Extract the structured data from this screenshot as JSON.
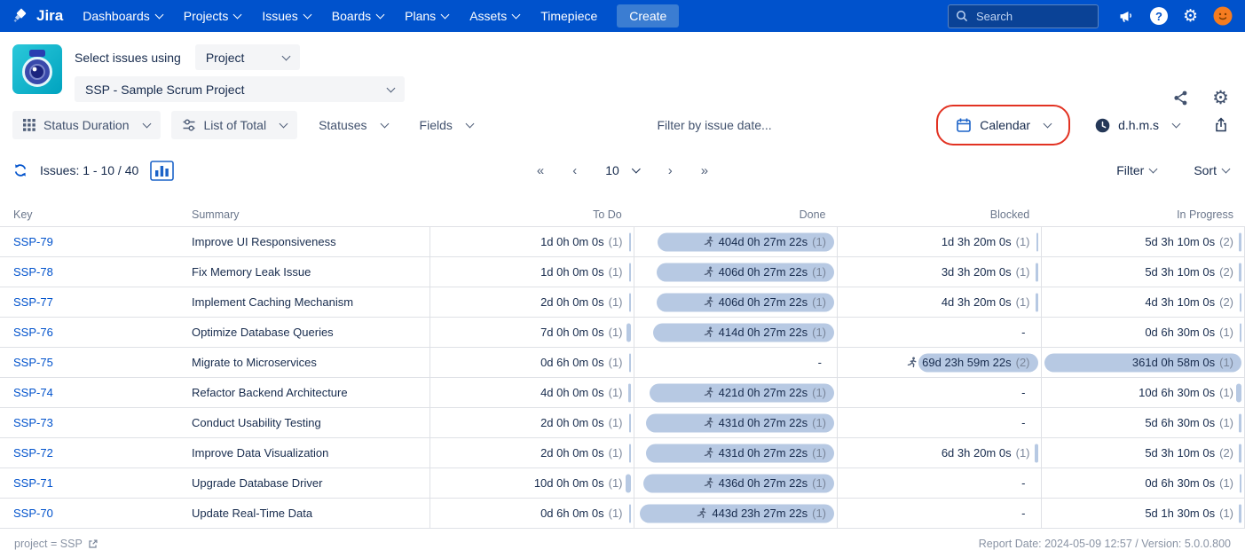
{
  "nav": {
    "brand": "Jira",
    "items": [
      "Dashboards",
      "Projects",
      "Issues",
      "Boards",
      "Plans",
      "Assets",
      "Timepiece"
    ],
    "create_label": "Create",
    "search_placeholder": "Search"
  },
  "panel": {
    "select_label": "Select issues using",
    "mode_value": "Project",
    "project_value": "SSP - Sample Scrum Project"
  },
  "toolbar": {
    "status_duration": "Status Duration",
    "list_of_total": "List of Total",
    "statuses": "Statuses",
    "fields": "Fields",
    "date_filter_placeholder": "Filter by issue date...",
    "calendar": "Calendar",
    "time_format": "d.h.m.s"
  },
  "pager": {
    "issues_label": "Issues: 1 - 10 / 40",
    "page_size": "10",
    "controls": {
      "first": "«",
      "prev": "‹",
      "next": "›",
      "last": "»"
    },
    "filter": "Filter",
    "sort": "Sort"
  },
  "icons": {
    "gear": "⚙"
  },
  "table": {
    "columns": [
      "Key",
      "Summary",
      "To Do",
      "Done",
      "Blocked",
      "In Progress"
    ],
    "rows": [
      {
        "key": "SSP-79",
        "summary": "Improve UI Responsiveness",
        "todo": {
          "text": "1d 0h 0m 0s",
          "count": "(1)",
          "bar": 0.5,
          "runner": false
        },
        "done": {
          "text": "404d 0h 27m 22s",
          "count": "(1)",
          "bar": 87,
          "runner": true
        },
        "blocked": {
          "text": "1d 3h 20m 0s",
          "count": "(1)",
          "bar": 0.5,
          "runner": false
        },
        "inprogress": {
          "text": "5d 3h 10m 0s",
          "count": "(2)",
          "bar": 1.3,
          "runner": false
        }
      },
      {
        "key": "SSP-78",
        "summary": "Fix Memory Leak Issue",
        "todo": {
          "text": "1d 0h 0m 0s",
          "count": "(1)",
          "bar": 0.5,
          "runner": false
        },
        "done": {
          "text": "406d 0h 27m 22s",
          "count": "(1)",
          "bar": 87.5,
          "runner": true
        },
        "blocked": {
          "text": "3d 3h 20m 0s",
          "count": "(1)",
          "bar": 0.9,
          "runner": false
        },
        "inprogress": {
          "text": "5d 3h 10m 0s",
          "count": "(2)",
          "bar": 1.3,
          "runner": false
        }
      },
      {
        "key": "SSP-77",
        "summary": "Implement Caching Mechanism",
        "todo": {
          "text": "2d 0h 0m 0s",
          "count": "(1)",
          "bar": 0.7,
          "runner": false
        },
        "done": {
          "text": "406d 0h 27m 22s",
          "count": "(1)",
          "bar": 87.5,
          "runner": true
        },
        "blocked": {
          "text": "4d 3h 20m 0s",
          "count": "(1)",
          "bar": 1.1,
          "runner": false
        },
        "inprogress": {
          "text": "4d 3h 10m 0s",
          "count": "(2)",
          "bar": 1.1,
          "runner": false
        }
      },
      {
        "key": "SSP-76",
        "summary": "Optimize Database Queries",
        "todo": {
          "text": "7d 0h 0m 0s",
          "count": "(1)",
          "bar": 1.8,
          "runner": false
        },
        "done": {
          "text": "414d 0h 27m 22s",
          "count": "(1)",
          "bar": 89.5,
          "runner": true
        },
        "blocked": {
          "text": "-",
          "count": "",
          "bar": 0,
          "runner": false
        },
        "inprogress": {
          "text": "0d 6h 30m 0s",
          "count": "(1)",
          "bar": 0.4,
          "runner": false
        }
      },
      {
        "key": "SSP-75",
        "summary": "Migrate to Microservices",
        "todo": {
          "text": "0d 6h 0m 0s",
          "count": "(1)",
          "bar": 0.4,
          "runner": false
        },
        "done": {
          "text": "-",
          "count": "",
          "bar": 0,
          "runner": false
        },
        "blocked": {
          "text": "69d 23h 59m 22s",
          "count": "(2)",
          "bar": 59,
          "runner": true
        },
        "inprogress": {
          "text": "361d 0h 58m 0s",
          "count": "(1)",
          "bar": 97,
          "runner": false
        }
      },
      {
        "key": "SSP-74",
        "summary": "Refactor Backend Architecture",
        "todo": {
          "text": "4d 0h 0m 0s",
          "count": "(1)",
          "bar": 1.1,
          "runner": false
        },
        "done": {
          "text": "421d 0h 27m 22s",
          "count": "(1)",
          "bar": 91,
          "runner": true
        },
        "blocked": {
          "text": "-",
          "count": "",
          "bar": 0,
          "runner": false
        },
        "inprogress": {
          "text": "10d 6h 30m 0s",
          "count": "(1)",
          "bar": 2.5,
          "runner": false
        }
      },
      {
        "key": "SSP-73",
        "summary": "Conduct Usability Testing",
        "todo": {
          "text": "2d 0h 0m 0s",
          "count": "(1)",
          "bar": 0.7,
          "runner": false
        },
        "done": {
          "text": "431d 0h 27m 22s",
          "count": "(1)",
          "bar": 93,
          "runner": true
        },
        "blocked": {
          "text": "-",
          "count": "",
          "bar": 0,
          "runner": false
        },
        "inprogress": {
          "text": "5d 6h 30m 0s",
          "count": "(1)",
          "bar": 1.4,
          "runner": false
        }
      },
      {
        "key": "SSP-72",
        "summary": "Improve Data Visualization",
        "todo": {
          "text": "2d 0h 0m 0s",
          "count": "(1)",
          "bar": 0.7,
          "runner": false
        },
        "done": {
          "text": "431d 0h 27m 22s",
          "count": "(1)",
          "bar": 93,
          "runner": true
        },
        "blocked": {
          "text": "6d 3h 20m 0s",
          "count": "(1)",
          "bar": 1.5,
          "runner": false
        },
        "inprogress": {
          "text": "5d 3h 10m 0s",
          "count": "(2)",
          "bar": 1.3,
          "runner": false
        }
      },
      {
        "key": "SSP-71",
        "summary": "Upgrade Database Driver",
        "todo": {
          "text": "10d 0h 0m 0s",
          "count": "(1)",
          "bar": 2.5,
          "runner": false
        },
        "done": {
          "text": "436d 0h 27m 22s",
          "count": "(1)",
          "bar": 94,
          "runner": true
        },
        "blocked": {
          "text": "-",
          "count": "",
          "bar": 0,
          "runner": false
        },
        "inprogress": {
          "text": "0d 6h 30m 0s",
          "count": "(1)",
          "bar": 0.4,
          "runner": false
        }
      },
      {
        "key": "SSP-70",
        "summary": "Update Real-Time Data",
        "todo": {
          "text": "0d 6h 0m 0s",
          "count": "(1)",
          "bar": 0.4,
          "runner": false
        },
        "done": {
          "text": "443d 23h 27m 22s",
          "count": "(1)",
          "bar": 96,
          "runner": true
        },
        "blocked": {
          "text": "-",
          "count": "",
          "bar": 0,
          "runner": false
        },
        "inprogress": {
          "text": "5d 1h 30m 0s",
          "count": "(1)",
          "bar": 1.3,
          "runner": false
        }
      }
    ]
  },
  "footer": {
    "left": "project = SSP",
    "right": "Report Date: 2024-05-09 12:57 / Version: 5.0.0.800"
  },
  "colors": {
    "header_bg": "#0052CC",
    "create_bg": "#3B7DD2",
    "search_bg": "#0A4296",
    "link": "#0052CC",
    "navy": "#172B4D",
    "text_gray": "#6B778C",
    "count_gray": "#7A869A",
    "btn_bg": "#F4F5F7",
    "btn_text": "#42526E",
    "border": "#DFE1E6",
    "bar_fill": "#B7C9E3",
    "annotation_red": "#E23222",
    "icon_gray": "#505F79",
    "icon_blue": "#1C63C8",
    "avatar_orange": "#F57C20"
  }
}
